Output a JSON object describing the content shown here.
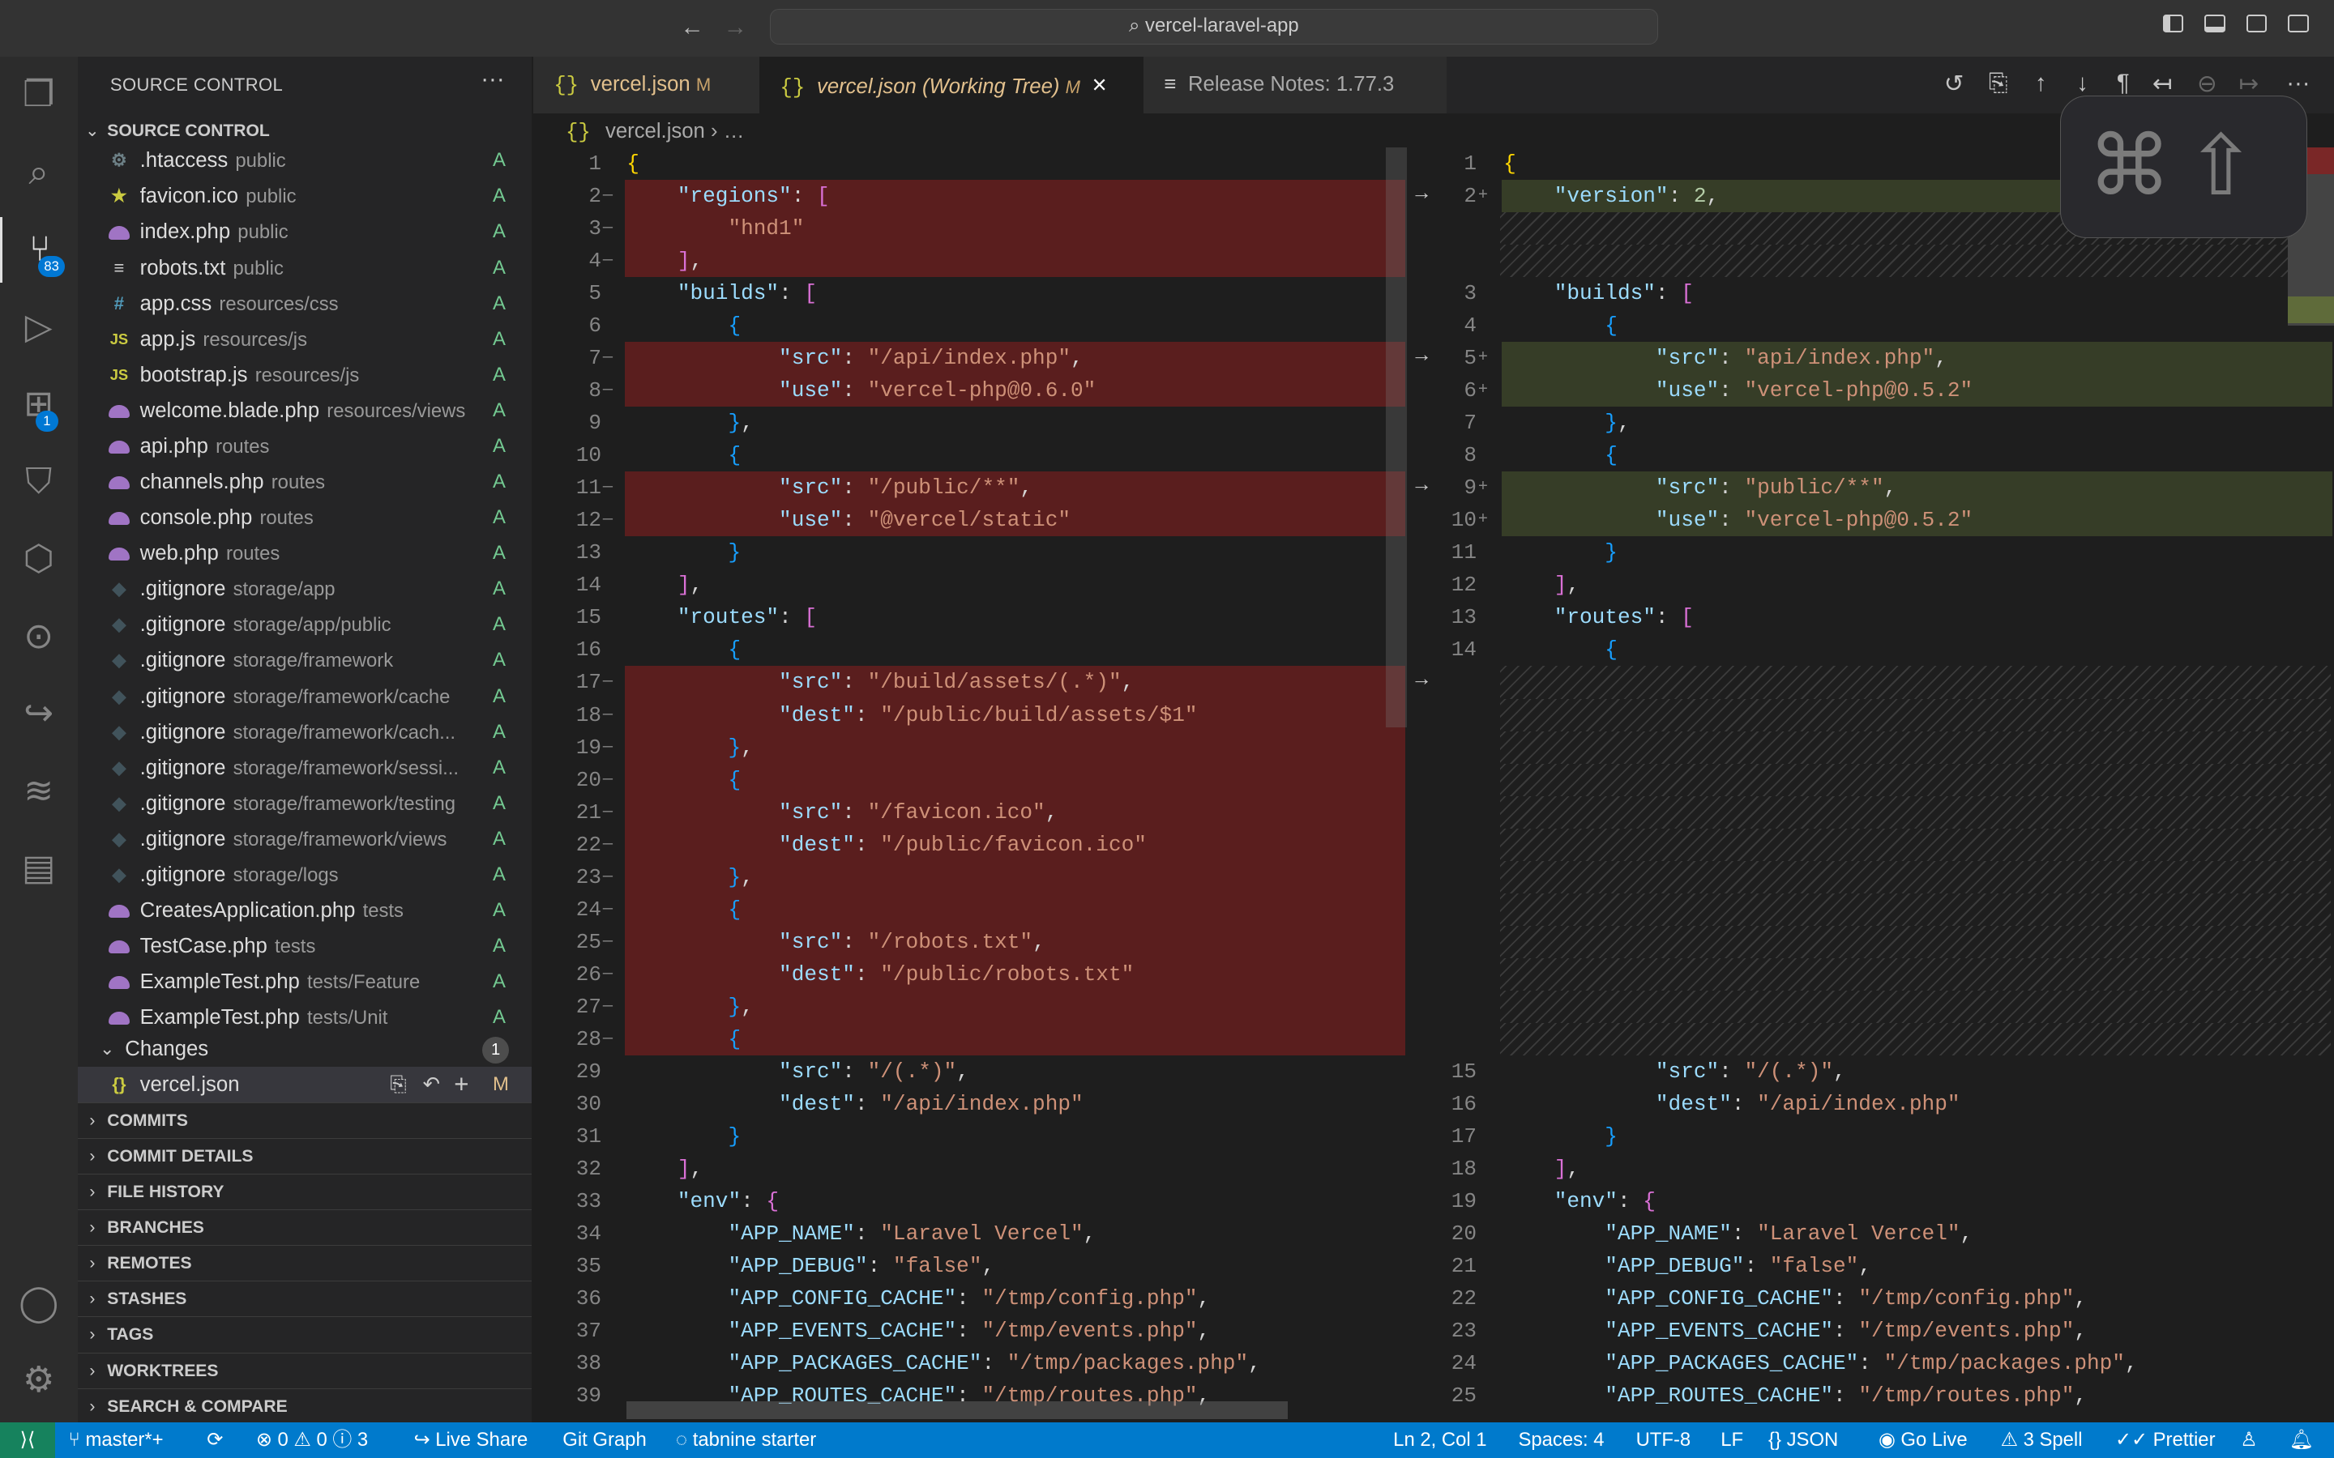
{
  "titlebar": {
    "search": "vercel-laravel-app",
    "search_icon": "search-icon",
    "back": "←",
    "forward": "→"
  },
  "activity": {
    "scm_badge": "83",
    "ext_badge": "1"
  },
  "sidebar": {
    "title": "SOURCE CONTROL",
    "more": "···",
    "section": "SOURCE CONTROL",
    "files": [
      {
        "icon": "gear",
        "name": ".htaccess",
        "dir": "public",
        "status": "A"
      },
      {
        "icon": "star",
        "name": "favicon.ico",
        "dir": "public",
        "status": "A"
      },
      {
        "icon": "php",
        "name": "index.php",
        "dir": "public",
        "status": "A"
      },
      {
        "icon": "txt",
        "name": "robots.txt",
        "dir": "public",
        "status": "A"
      },
      {
        "icon": "css",
        "name": "app.css",
        "dir": "resources/css",
        "status": "A"
      },
      {
        "icon": "js",
        "name": "app.js",
        "dir": "resources/js",
        "status": "A"
      },
      {
        "icon": "js",
        "name": "bootstrap.js",
        "dir": "resources/js",
        "status": "A"
      },
      {
        "icon": "php",
        "name": "welcome.blade.php",
        "dir": "resources/views",
        "status": "A"
      },
      {
        "icon": "php",
        "name": "api.php",
        "dir": "routes",
        "status": "A"
      },
      {
        "icon": "php",
        "name": "channels.php",
        "dir": "routes",
        "status": "A"
      },
      {
        "icon": "php",
        "name": "console.php",
        "dir": "routes",
        "status": "A"
      },
      {
        "icon": "php",
        "name": "web.php",
        "dir": "routes",
        "status": "A"
      },
      {
        "icon": "git",
        "name": ".gitignore",
        "dir": "storage/app",
        "status": "A"
      },
      {
        "icon": "git",
        "name": ".gitignore",
        "dir": "storage/app/public",
        "status": "A"
      },
      {
        "icon": "git",
        "name": ".gitignore",
        "dir": "storage/framework",
        "status": "A"
      },
      {
        "icon": "git",
        "name": ".gitignore",
        "dir": "storage/framework/cache",
        "status": "A"
      },
      {
        "icon": "git",
        "name": ".gitignore",
        "dir": "storage/framework/cach...",
        "status": "A"
      },
      {
        "icon": "git",
        "name": ".gitignore",
        "dir": "storage/framework/sessi...",
        "status": "A"
      },
      {
        "icon": "git",
        "name": ".gitignore",
        "dir": "storage/framework/testing",
        "status": "A"
      },
      {
        "icon": "git",
        "name": ".gitignore",
        "dir": "storage/framework/views",
        "status": "A"
      },
      {
        "icon": "git",
        "name": ".gitignore",
        "dir": "storage/logs",
        "status": "A"
      },
      {
        "icon": "php",
        "name": "CreatesApplication.php",
        "dir": "tests",
        "status": "A"
      },
      {
        "icon": "php",
        "name": "TestCase.php",
        "dir": "tests",
        "status": "A"
      },
      {
        "icon": "php",
        "name": "ExampleTest.php",
        "dir": "tests/Feature",
        "status": "A"
      },
      {
        "icon": "php",
        "name": "ExampleTest.php",
        "dir": "tests/Unit",
        "status": "A"
      }
    ],
    "changes": {
      "label": "Changes",
      "count": "1",
      "file": "vercel.json",
      "status": "M"
    },
    "sections": [
      "COMMITS",
      "COMMIT DETAILS",
      "FILE HISTORY",
      "BRANCHES",
      "REMOTES",
      "STASHES",
      "TAGS",
      "WORKTREES",
      "SEARCH & COMPARE"
    ]
  },
  "tabs": [
    {
      "icon": "{}",
      "label": "vercel.json",
      "badge": "M"
    },
    {
      "icon": "{}",
      "label": "vercel.json (Working Tree)",
      "badge": "M",
      "close": "×"
    },
    {
      "icon": "≡",
      "label": "Release Notes: 1.77.3"
    }
  ],
  "breadcrumb": {
    "icon": "{}",
    "file": "vercel.json",
    "rest": "…"
  },
  "overlay": {
    "cmd": "⌘",
    "shift": "⇧"
  },
  "left": [
    {
      "n": "1",
      "t": "",
      "c": "{"
    },
    {
      "n": "2",
      "t": "del",
      "c": "    \"regions\": ["
    },
    {
      "n": "3",
      "t": "del",
      "c": "        \"hnd1\""
    },
    {
      "n": "4",
      "t": "del",
      "c": "    ],"
    },
    {
      "n": "5",
      "t": "",
      "c": "    \"builds\": ["
    },
    {
      "n": "6",
      "t": "",
      "c": "        {"
    },
    {
      "n": "7",
      "t": "del",
      "c": "            \"src\": \"/api/index.php\","
    },
    {
      "n": "8",
      "t": "del",
      "c": "            \"use\": \"vercel-php@0.6.0\""
    },
    {
      "n": "9",
      "t": "",
      "c": "        },"
    },
    {
      "n": "10",
      "t": "",
      "c": "        {"
    },
    {
      "n": "11",
      "t": "del",
      "c": "            \"src\": \"/public/**\","
    },
    {
      "n": "12",
      "t": "del",
      "c": "            \"use\": \"@vercel/static\""
    },
    {
      "n": "13",
      "t": "",
      "c": "        }"
    },
    {
      "n": "14",
      "t": "",
      "c": "    ],"
    },
    {
      "n": "15",
      "t": "",
      "c": "    \"routes\": ["
    },
    {
      "n": "16",
      "t": "",
      "c": "        {"
    },
    {
      "n": "17",
      "t": "del",
      "c": "            \"src\": \"/build/assets/(.*)\","
    },
    {
      "n": "18",
      "t": "del",
      "c": "            \"dest\": \"/public/build/assets/$1\""
    },
    {
      "n": "19",
      "t": "del",
      "c": "        },"
    },
    {
      "n": "20",
      "t": "del",
      "c": "        {"
    },
    {
      "n": "21",
      "t": "del",
      "c": "            \"src\": \"/favicon.ico\","
    },
    {
      "n": "22",
      "t": "del",
      "c": "            \"dest\": \"/public/favicon.ico\""
    },
    {
      "n": "23",
      "t": "del",
      "c": "        },"
    },
    {
      "n": "24",
      "t": "del",
      "c": "        {"
    },
    {
      "n": "25",
      "t": "del",
      "c": "            \"src\": \"/robots.txt\","
    },
    {
      "n": "26",
      "t": "del",
      "c": "            \"dest\": \"/public/robots.txt\""
    },
    {
      "n": "27",
      "t": "del",
      "c": "        },"
    },
    {
      "n": "28",
      "t": "del",
      "c": "        {"
    },
    {
      "n": "29",
      "t": "",
      "c": "            \"src\": \"/(.*)\","
    },
    {
      "n": "30",
      "t": "",
      "c": "            \"dest\": \"/api/index.php\""
    },
    {
      "n": "31",
      "t": "",
      "c": "        }"
    },
    {
      "n": "32",
      "t": "",
      "c": "    ],"
    },
    {
      "n": "33",
      "t": "",
      "c": "    \"env\": {"
    },
    {
      "n": "34",
      "t": "",
      "c": "        \"APP_NAME\": \"Laravel Vercel\","
    },
    {
      "n": "35",
      "t": "",
      "c": "        \"APP_DEBUG\": \"false\","
    },
    {
      "n": "36",
      "t": "",
      "c": "        \"APP_CONFIG_CACHE\": \"/tmp/config.php\","
    },
    {
      "n": "37",
      "t": "",
      "c": "        \"APP_EVENTS_CACHE\": \"/tmp/events.php\","
    },
    {
      "n": "38",
      "t": "",
      "c": "        \"APP_PACKAGES_CACHE\": \"/tmp/packages.php\","
    },
    {
      "n": "39",
      "t": "",
      "c": "        \"APP_ROUTES_CACHE\": \"/tmp/routes.php\","
    }
  ],
  "right": [
    {
      "n": "1",
      "t": "",
      "c": "{"
    },
    {
      "n": "2",
      "t": "ins",
      "c": "    \"version\": 2,"
    },
    {
      "n": "",
      "t": "pad",
      "c": ""
    },
    {
      "n": "",
      "t": "pad",
      "c": ""
    },
    {
      "n": "3",
      "t": "",
      "c": "    \"builds\": ["
    },
    {
      "n": "4",
      "t": "",
      "c": "        {"
    },
    {
      "n": "5",
      "t": "ins",
      "c": "            \"src\": \"api/index.php\","
    },
    {
      "n": "6",
      "t": "ins",
      "c": "            \"use\": \"vercel-php@0.5.2\""
    },
    {
      "n": "7",
      "t": "",
      "c": "        },"
    },
    {
      "n": "8",
      "t": "",
      "c": "        {"
    },
    {
      "n": "9",
      "t": "ins",
      "c": "            \"src\": \"public/**\","
    },
    {
      "n": "10",
      "t": "ins",
      "c": "            \"use\": \"vercel-php@0.5.2\""
    },
    {
      "n": "11",
      "t": "",
      "c": "        }"
    },
    {
      "n": "12",
      "t": "",
      "c": "    ],"
    },
    {
      "n": "13",
      "t": "",
      "c": "    \"routes\": ["
    },
    {
      "n": "14",
      "t": "",
      "c": "        {"
    },
    {
      "n": "",
      "t": "pad",
      "c": ""
    },
    {
      "n": "",
      "t": "pad",
      "c": ""
    },
    {
      "n": "",
      "t": "pad",
      "c": ""
    },
    {
      "n": "",
      "t": "pad",
      "c": ""
    },
    {
      "n": "",
      "t": "pad",
      "c": ""
    },
    {
      "n": "",
      "t": "pad",
      "c": ""
    },
    {
      "n": "",
      "t": "pad",
      "c": ""
    },
    {
      "n": "",
      "t": "pad",
      "c": ""
    },
    {
      "n": "",
      "t": "pad",
      "c": ""
    },
    {
      "n": "",
      "t": "pad",
      "c": ""
    },
    {
      "n": "",
      "t": "pad",
      "c": ""
    },
    {
      "n": "",
      "t": "pad",
      "c": ""
    },
    {
      "n": "15",
      "t": "",
      "c": "            \"src\": \"/(.*)\","
    },
    {
      "n": "16",
      "t": "",
      "c": "            \"dest\": \"/api/index.php\""
    },
    {
      "n": "17",
      "t": "",
      "c": "        }"
    },
    {
      "n": "18",
      "t": "",
      "c": "    ],"
    },
    {
      "n": "19",
      "t": "",
      "c": "    \"env\": {"
    },
    {
      "n": "20",
      "t": "",
      "c": "        \"APP_NAME\": \"Laravel Vercel\","
    },
    {
      "n": "21",
      "t": "",
      "c": "        \"APP_DEBUG\": \"false\","
    },
    {
      "n": "22",
      "t": "",
      "c": "        \"APP_CONFIG_CACHE\": \"/tmp/config.php\","
    },
    {
      "n": "23",
      "t": "",
      "c": "        \"APP_EVENTS_CACHE\": \"/tmp/events.php\","
    },
    {
      "n": "24",
      "t": "",
      "c": "        \"APP_PACKAGES_CACHE\": \"/tmp/packages.php\","
    },
    {
      "n": "25",
      "t": "",
      "c": "        \"APP_ROUTES_CACHE\": \"/tmp/routes.php\","
    }
  ],
  "diff_arrow": "→",
  "status": {
    "remote": "⟩⟨",
    "branch": "master*+",
    "sync": "⟳",
    "problems": "⊗ 0 ⚠ 0 ⓘ 3",
    "liveshare": "Live Share",
    "gitgraph": "Git Graph",
    "tabnine": "tabnine starter",
    "position": "Ln 2, Col 1",
    "spaces": "Spaces: 4",
    "encoding": "UTF-8",
    "eol": "LF",
    "language": "{} JSON",
    "golive": "Go Live",
    "spell": "⚠ 3 Spell",
    "prettier": "✓✓ Prettier",
    "account": "♙",
    "bell": "🔔︎"
  },
  "colors": {
    "accent": "#007acc",
    "deleted": "#5a1e1e",
    "inserted": "#363d27",
    "added": "#73c991",
    "modified": "#e2c08d"
  }
}
